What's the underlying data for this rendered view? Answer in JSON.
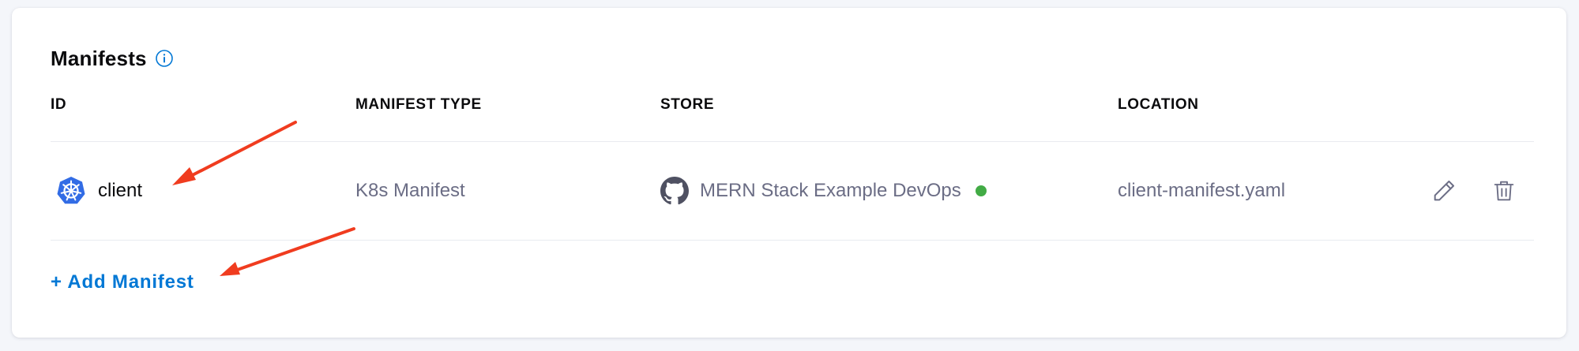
{
  "manifests": {
    "title": "Manifests",
    "columns": {
      "id": "ID",
      "manifest_type": "MANIFEST TYPE",
      "store": "STORE",
      "location": "LOCATION"
    },
    "rows": [
      {
        "id": "client",
        "id_icon": "kubernetes-icon",
        "manifest_type": "K8s Manifest",
        "store": "MERN Stack Example DevOps",
        "store_icon": "github-icon",
        "store_status_color": "#42ab45",
        "location": "client-manifest.yaml"
      }
    ],
    "add_label": "+ Add Manifest"
  },
  "colors": {
    "accent": "#0278d5",
    "annotation_arrow": "#f03c1f",
    "kubernetes_blue": "#326ce5"
  }
}
